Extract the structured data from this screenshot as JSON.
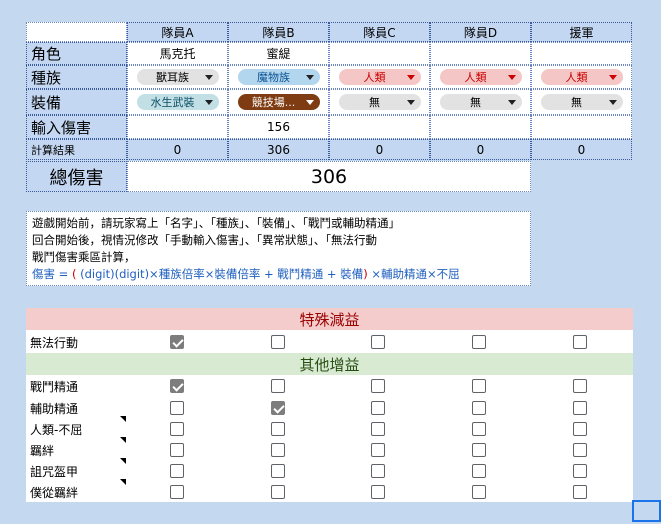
{
  "columns": [
    "隊員A",
    "隊員B",
    "隊員C",
    "隊員D",
    "援軍"
  ],
  "row_labels": {
    "role": "角色",
    "race": "種族",
    "equip": "裝備",
    "input": "輸入傷害",
    "result": "計算結果"
  },
  "roles": [
    "馬克托",
    "蜜緹",
    "",
    "",
    ""
  ],
  "races": [
    {
      "text": "獸耳族",
      "style": "gray"
    },
    {
      "text": "魔物族",
      "style": "blue"
    },
    {
      "text": "人類",
      "style": "red"
    },
    {
      "text": "人類",
      "style": "red"
    },
    {
      "text": "人類",
      "style": "red"
    }
  ],
  "equips": [
    {
      "text": "水生武裝",
      "style": "teal"
    },
    {
      "text": "競技場...",
      "style": "brown"
    },
    {
      "text": "無",
      "style": "gray"
    },
    {
      "text": "無",
      "style": "gray"
    },
    {
      "text": "無",
      "style": "gray"
    }
  ],
  "inputs": [
    "",
    "156",
    "",
    "",
    ""
  ],
  "results": [
    "0",
    "306",
    "0",
    "0",
    "0"
  ],
  "total": {
    "label": "總傷害",
    "value": "306"
  },
  "instructions": {
    "line1": "遊戲開始前，請玩家寫上「名字」、「種族」、「裝備」、「戰鬥或輔助精通」",
    "line2": "回合開始後，視情況修改「手動輸入傷害」、「異常狀態」、「無法行動",
    "line3": "戰鬥傷害乘區計算，",
    "line4_prefix": "傷害 = ",
    "line4_paren_open": "(",
    "line4_blue": " (digit)(digit)×種族倍率×裝備倍率 + 戰鬥精通 + 裝備",
    "line4_paren_close": ")",
    "line4_suffix": " ×輔助精通×不屈"
  },
  "debuff": {
    "title": "特殊減益",
    "rows": [
      {
        "label": "無法行動",
        "checks": [
          true,
          false,
          false,
          false,
          false
        ],
        "note": false
      }
    ]
  },
  "buff": {
    "title": "其他增益",
    "rows": [
      {
        "label": "戰鬥精通",
        "checks": [
          true,
          false,
          false,
          false,
          false
        ],
        "note": false
      },
      {
        "label": "輔助精通",
        "checks": [
          false,
          true,
          false,
          false,
          false
        ],
        "note": false
      },
      {
        "label": "人類-不屈",
        "checks": [
          false,
          false,
          false,
          false,
          false
        ],
        "note": true
      },
      {
        "label": "羈絆",
        "checks": [
          false,
          false,
          false,
          false,
          false
        ],
        "note": true
      },
      {
        "label": "詛咒盔甲",
        "checks": [
          false,
          false,
          false,
          false,
          false
        ],
        "note": true
      },
      {
        "label": "僕從羈絆",
        "checks": [
          false,
          false,
          false,
          false,
          false
        ],
        "note": true
      }
    ]
  }
}
